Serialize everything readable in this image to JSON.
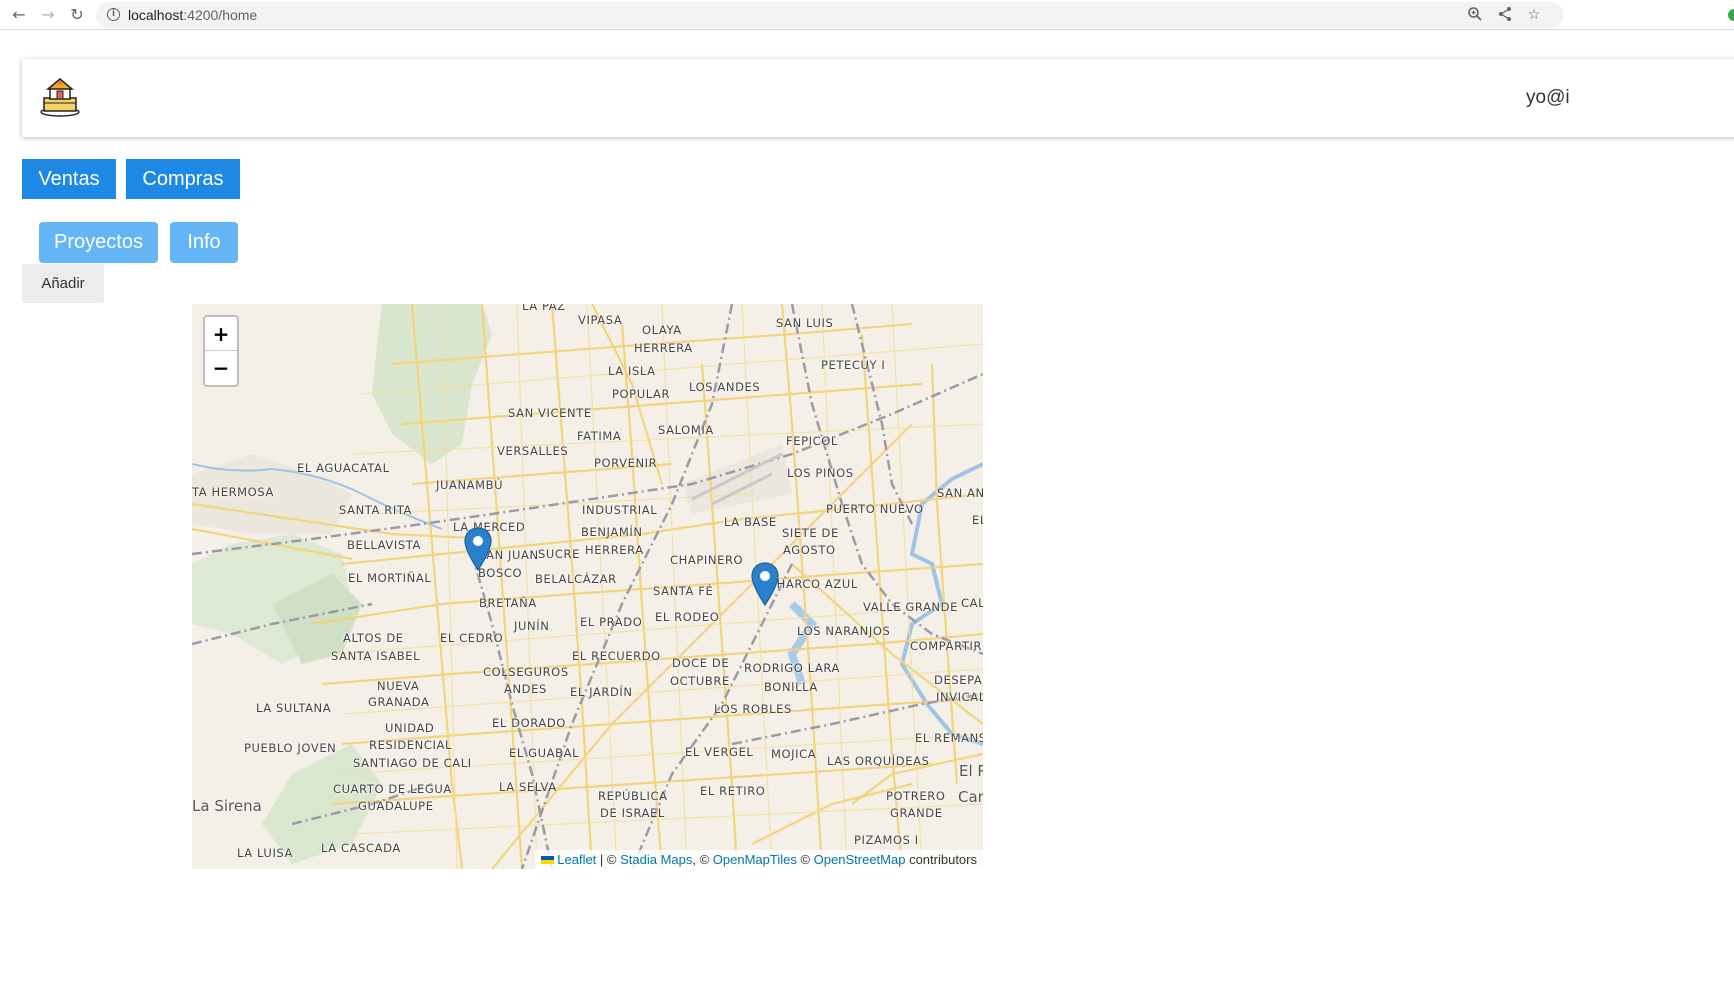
{
  "browser": {
    "url_host": "localhost",
    "url_path": ":4200/home",
    "icons": [
      "back-icon",
      "forward-icon",
      "reload-icon",
      "info-icon",
      "zoom-icon",
      "share-icon",
      "star-icon"
    ]
  },
  "header": {
    "logo_icon": "house-cake-icon",
    "user_email": "yo@i"
  },
  "toolbar": {
    "ventas_label": "Ventas",
    "compras_label": "Compras",
    "proyectos_label": "Proyectos",
    "info_label": "Info",
    "add_label": "Añadir"
  },
  "map": {
    "zoom_in_label": "+",
    "zoom_out_label": "−",
    "attribution": {
      "leaflet": "Leaflet",
      "sep1": " | © ",
      "stadia": "Stadia Maps",
      "sep2": ", © ",
      "openmaptiles": "OpenMapTiles",
      "sep3": " © ",
      "osm": "OpenStreetMap",
      "tail": " contributors"
    },
    "places": {
      "la_paz": "LA PAZ",
      "vipasa": "VIPASA",
      "olaya": "OLAYA",
      "herrera_top": "HERRERA",
      "san_luis": "SAN LUIS",
      "la_isla": "LA ISLA",
      "petecuy": "PETECUY I",
      "los_andes": "LOS ANDES",
      "popular": "POPULAR",
      "san_vicente": "SAN VICENTE",
      "salomia": "SALOMIA",
      "fatima": "FATIMA",
      "fepicol": "FEPICOL",
      "versalles": "VERSALLES",
      "porvenir": "PORVENIR",
      "el_aguacatal": "EL AGUACATAL",
      "los_pinos": "LOS PINOS",
      "juanambu": "JUANAMBÚ",
      "ta_hermosa": "TA HERMOSA",
      "san_an": "SAN AN",
      "santa_rita": "SANTA RITA",
      "industrial": "INDUSTRIAL",
      "puerto_nuevo": "PUERTO NUEVO",
      "la_merced": "LA MERCED",
      "la_base": "LA BASE",
      "el_right": "EL",
      "benjamin": "BENJAMÍN",
      "siete_de": "SIETE DE",
      "bellavista": "BELLAVISTA",
      "san_juan": "SAN JUAN",
      "sucre": "SUCRE",
      "herrera_mid": "HERRERA",
      "agosto": "AGOSTO",
      "chapinero": "CHAPINERO",
      "bosco": "BOSCO",
      "el_mortinal": "EL MORTIÑAL",
      "belalcazar": "BELALCÁZAR",
      "charco_azul": "CHARCO AZUL",
      "santa_fe": "SANTA FÉ",
      "valle_grande": "VALLE GRANDE",
      "cal": "CAL",
      "bretana": "BRETAÑA",
      "junin": "JUNÍN",
      "el_prado": "EL PRADO",
      "el_rodeo": "EL RODEO",
      "los_naranjos": "LOS NARANJOS",
      "altos_de": "ALTOS DE",
      "el_cedro": "EL CEDRO",
      "compartir": "COMPARTIR",
      "santa_isabel": "SANTA ISABEL",
      "el_recuerdo": "EL RECUERDO",
      "doce_de": "DOCE DE",
      "rodrigo_lara": "RODRIGO LARA",
      "colseguros": "COLSEGUROS",
      "desepa": "DESEPA",
      "nueva": "NUEVA",
      "andes": "ANDES",
      "el_jardin": "EL JARDÍN",
      "octubre": "OCTUBRE",
      "bonilla": "BONILLA",
      "invical": "INVICAL",
      "granada": "GRANADA",
      "la_sultana": "LA SULTANA",
      "los_robles": "LOS ROBLES",
      "unidad": "UNIDAD",
      "el_dorado": "EL DORADO",
      "el_remans": "EL REMANS",
      "residencial": "RESIDENCIAL",
      "pueblo_joven": "PUEBLO JOVEN",
      "el_vergel": "EL VERGEL",
      "el_guabal": "EL GUABAL",
      "mojica": "MOJICA",
      "las_orquideas": "LAS ORQUÍDEAS",
      "santiago_de_cali": "SANTIAGO DE CALI",
      "el_p": "El P",
      "la_selva": "LA SELVA",
      "cuarto_de_legua": "CUARTO DE LEGUA",
      "el_retiro": "EL RETIRO",
      "republica": "REPÚBLICA",
      "potrero": "POTRERO",
      "car": "Car",
      "la_sirena": "La Sirena",
      "guadalupe": "GUADALUPE",
      "de_israel": "DE ISRAEL",
      "grande": "GRANDE",
      "pizamos": "PIZAMOS I",
      "la_luisa": "LA LUISA",
      "la_cascada": "LA CASCADA"
    },
    "markers": [
      "map-pin-icon",
      "map-pin-icon"
    ]
  }
}
